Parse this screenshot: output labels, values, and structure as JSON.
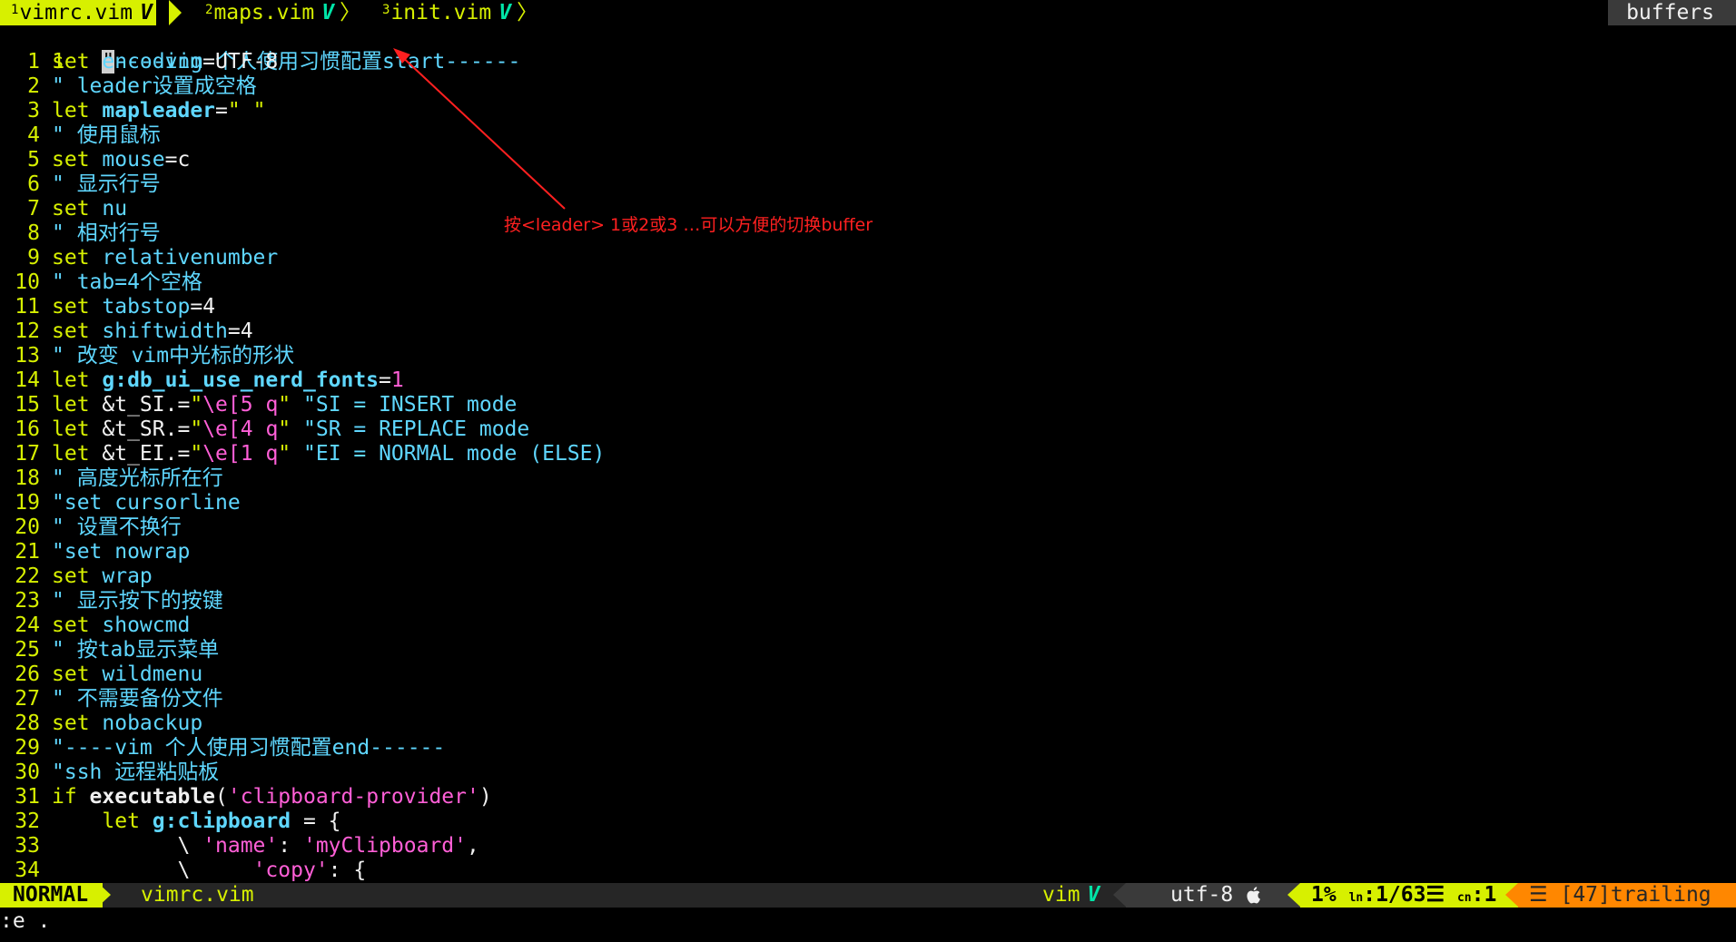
{
  "tabline": {
    "tabs": [
      {
        "num": "1",
        "name": "vimrc.vim",
        "check": "V"
      },
      {
        "num": "2",
        "name": "maps.vim",
        "check": "V"
      },
      {
        "num": "3",
        "name": "init.vim",
        "check": "V"
      }
    ],
    "separator": "〉",
    "buffers_label": "buffers"
  },
  "editor": {
    "cursor_line": {
      "number": "1",
      "cursor_char": "\"",
      "text": "----vim 个人使用习惯配置start------"
    },
    "lines": [
      {
        "n": "1",
        "parts": [
          {
            "t": "set ",
            "c": "kw"
          },
          {
            "t": "encoding",
            "c": "opt"
          },
          {
            "t": "=UTF-8",
            "c": "plain"
          }
        ]
      },
      {
        "n": "2",
        "parts": [
          {
            "t": "\" leader设置成空格",
            "c": "cm"
          }
        ]
      },
      {
        "n": "3",
        "parts": [
          {
            "t": "let ",
            "c": "kw"
          },
          {
            "t": "mapleader",
            "c": "var"
          },
          {
            "t": "=",
            "c": "plain"
          },
          {
            "t": "\" \"",
            "c": "kw"
          }
        ]
      },
      {
        "n": "4",
        "parts": [
          {
            "t": "\" 使用鼠标",
            "c": "cm"
          }
        ]
      },
      {
        "n": "5",
        "parts": [
          {
            "t": "set ",
            "c": "kw"
          },
          {
            "t": "mouse",
            "c": "opt"
          },
          {
            "t": "=c",
            "c": "plain"
          }
        ]
      },
      {
        "n": "6",
        "parts": [
          {
            "t": "\" 显示行号",
            "c": "cm"
          }
        ]
      },
      {
        "n": "7",
        "parts": [
          {
            "t": "set ",
            "c": "kw"
          },
          {
            "t": "nu",
            "c": "opt"
          }
        ]
      },
      {
        "n": "8",
        "parts": [
          {
            "t": "\" 相对行号",
            "c": "cm"
          }
        ]
      },
      {
        "n": "9",
        "parts": [
          {
            "t": "set ",
            "c": "kw"
          },
          {
            "t": "relativenumber",
            "c": "opt"
          }
        ]
      },
      {
        "n": "10",
        "parts": [
          {
            "t": "\" tab=4个空格",
            "c": "cm"
          }
        ]
      },
      {
        "n": "11",
        "parts": [
          {
            "t": "set ",
            "c": "kw"
          },
          {
            "t": "tabstop",
            "c": "opt"
          },
          {
            "t": "=4",
            "c": "plain"
          }
        ]
      },
      {
        "n": "12",
        "parts": [
          {
            "t": "set ",
            "c": "kw"
          },
          {
            "t": "shiftwidth",
            "c": "opt"
          },
          {
            "t": "=4",
            "c": "plain"
          }
        ]
      },
      {
        "n": "13",
        "parts": [
          {
            "t": "\" 改变 vim中光标的形状",
            "c": "cm"
          }
        ]
      },
      {
        "n": "14",
        "parts": [
          {
            "t": "let ",
            "c": "kw"
          },
          {
            "t": "g:db_ui_use_nerd_fonts",
            "c": "var"
          },
          {
            "t": "=",
            "c": "plain"
          },
          {
            "t": "1",
            "c": "num"
          }
        ]
      },
      {
        "n": "15",
        "parts": [
          {
            "t": "let ",
            "c": "kw"
          },
          {
            "t": "&t_SI",
            "c": "plain"
          },
          {
            "t": ".=",
            "c": "plain"
          },
          {
            "t": "\"",
            "c": "kw"
          },
          {
            "t": "\\e[5 q",
            "c": "str"
          },
          {
            "t": "\" ",
            "c": "kw"
          },
          {
            "t": "\"SI = INSERT mode",
            "c": "cm"
          }
        ]
      },
      {
        "n": "16",
        "parts": [
          {
            "t": "let ",
            "c": "kw"
          },
          {
            "t": "&t_SR",
            "c": "plain"
          },
          {
            "t": ".=",
            "c": "plain"
          },
          {
            "t": "\"",
            "c": "kw"
          },
          {
            "t": "\\e[4 q",
            "c": "str"
          },
          {
            "t": "\" ",
            "c": "kw"
          },
          {
            "t": "\"SR = REPLACE mode",
            "c": "cm"
          }
        ]
      },
      {
        "n": "17",
        "parts": [
          {
            "t": "let ",
            "c": "kw"
          },
          {
            "t": "&t_EI",
            "c": "plain"
          },
          {
            "t": ".=",
            "c": "plain"
          },
          {
            "t": "\"",
            "c": "kw"
          },
          {
            "t": "\\e[1 q",
            "c": "str"
          },
          {
            "t": "\" ",
            "c": "kw"
          },
          {
            "t": "\"EI = NORMAL mode (ELSE)",
            "c": "cm"
          }
        ]
      },
      {
        "n": "18",
        "parts": [
          {
            "t": "\" 高度光标所在行",
            "c": "cm"
          }
        ]
      },
      {
        "n": "19",
        "parts": [
          {
            "t": "\"set cursorline",
            "c": "cm"
          }
        ]
      },
      {
        "n": "20",
        "parts": [
          {
            "t": "\" 设置不换行",
            "c": "cm"
          }
        ]
      },
      {
        "n": "21",
        "parts": [
          {
            "t": "\"set nowrap",
            "c": "cm"
          }
        ]
      },
      {
        "n": "22",
        "parts": [
          {
            "t": "set ",
            "c": "kw"
          },
          {
            "t": "wrap",
            "c": "opt"
          }
        ]
      },
      {
        "n": "23",
        "parts": [
          {
            "t": "\" 显示按下的按键",
            "c": "cm"
          }
        ]
      },
      {
        "n": "24",
        "parts": [
          {
            "t": "set ",
            "c": "kw"
          },
          {
            "t": "showcmd",
            "c": "opt"
          }
        ]
      },
      {
        "n": "25",
        "parts": [
          {
            "t": "\" 按tab显示菜单",
            "c": "cm"
          }
        ]
      },
      {
        "n": "26",
        "parts": [
          {
            "t": "set ",
            "c": "kw"
          },
          {
            "t": "wildmenu",
            "c": "opt"
          }
        ]
      },
      {
        "n": "27",
        "parts": [
          {
            "t": "\" 不需要备份文件",
            "c": "cm"
          }
        ]
      },
      {
        "n": "28",
        "parts": [
          {
            "t": "set ",
            "c": "kw"
          },
          {
            "t": "nobackup",
            "c": "opt"
          }
        ]
      },
      {
        "n": "29",
        "parts": [
          {
            "t": "\"----vim 个人使用习惯配置end------",
            "c": "cm"
          }
        ]
      },
      {
        "n": "30",
        "parts": [
          {
            "t": "\"ssh 远程粘贴板",
            "c": "cm"
          }
        ]
      },
      {
        "n": "31",
        "parts": [
          {
            "t": "if ",
            "c": "kw"
          },
          {
            "t": "executable",
            "c": "fn"
          },
          {
            "t": "(",
            "c": "plain"
          },
          {
            "t": "'clipboard-provider'",
            "c": "str"
          },
          {
            "t": ")",
            "c": "plain"
          }
        ]
      },
      {
        "n": "32",
        "parts": [
          {
            "t": "    let ",
            "c": "kw"
          },
          {
            "t": "g:clipboard",
            "c": "var"
          },
          {
            "t": " = {",
            "c": "plain"
          }
        ]
      },
      {
        "n": "33",
        "parts": [
          {
            "t": "          \\ ",
            "c": "plain"
          },
          {
            "t": "'name'",
            "c": "str"
          },
          {
            "t": ": ",
            "c": "plain"
          },
          {
            "t": "'myClipboard'",
            "c": "str"
          },
          {
            "t": ",",
            "c": "plain"
          }
        ]
      },
      {
        "n": "34",
        "parts": [
          {
            "t": "          \\     ",
            "c": "plain"
          },
          {
            "t": "'copy'",
            "c": "str"
          },
          {
            "t": ": {",
            "c": "plain"
          }
        ]
      }
    ]
  },
  "annotation": {
    "text": "按<leader> 1或2或3 …可以方便的切换buffer",
    "color": "#ff2020"
  },
  "statusline": {
    "mode": "NORMAL",
    "filename": "vimrc.vim",
    "filetype": "vim",
    "filetype_check": "V",
    "encoding": "utf-8",
    "os_icon": "apple-icon",
    "percent": "1%",
    "line_label": "ln",
    "line": "1/63",
    "col_label": "cn",
    "col": "1",
    "warning": "[47]trailing"
  },
  "cmdline": {
    "text": ":e ."
  },
  "colors": {
    "accent": "#d7f000",
    "comment": "#5fd7ff",
    "string": "#ff5fd7",
    "warning": "#ff8700",
    "background": "#000000"
  }
}
